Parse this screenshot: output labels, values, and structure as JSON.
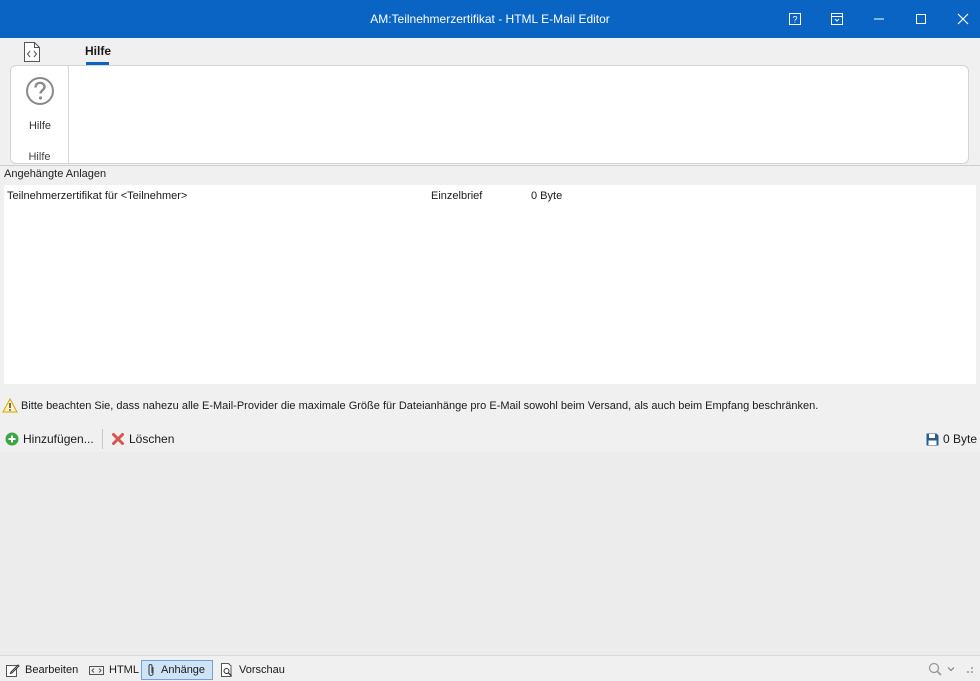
{
  "window": {
    "title": "AM:Teilnehmerzertifikat - HTML E-Mail Editor"
  },
  "ribbon": {
    "tab_hilfe": "Hilfe",
    "button_hilfe": "Hilfe",
    "group_hilfe": "Hilfe"
  },
  "attachments": {
    "section_title": "Angehängte Anlagen",
    "rows": [
      {
        "name": "Teilnehmerzertifikat für <Teilnehmer>",
        "type": "Einzelbrief",
        "size": "0 Byte"
      }
    ]
  },
  "notice": {
    "text": "Bitte beachten Sie, dass nahezu alle E-Mail-Provider die maximale Größe für Dateianhänge pro E-Mail sowohl beim Versand, als auch beim Empfang beschränken."
  },
  "toolbar": {
    "add_label": "Hinzufügen...",
    "delete_label": "Löschen",
    "total_size": "0 Byte"
  },
  "statusbar": {
    "tabs": [
      "Bearbeiten",
      "HTML",
      "Anhänge",
      "Vorschau"
    ],
    "active_tab": "Anhänge"
  },
  "colors": {
    "titlebar": "#0a64c4",
    "accent": "#0a64c4",
    "add_icon": "#3aa648",
    "delete_icon": "#d9534f"
  }
}
